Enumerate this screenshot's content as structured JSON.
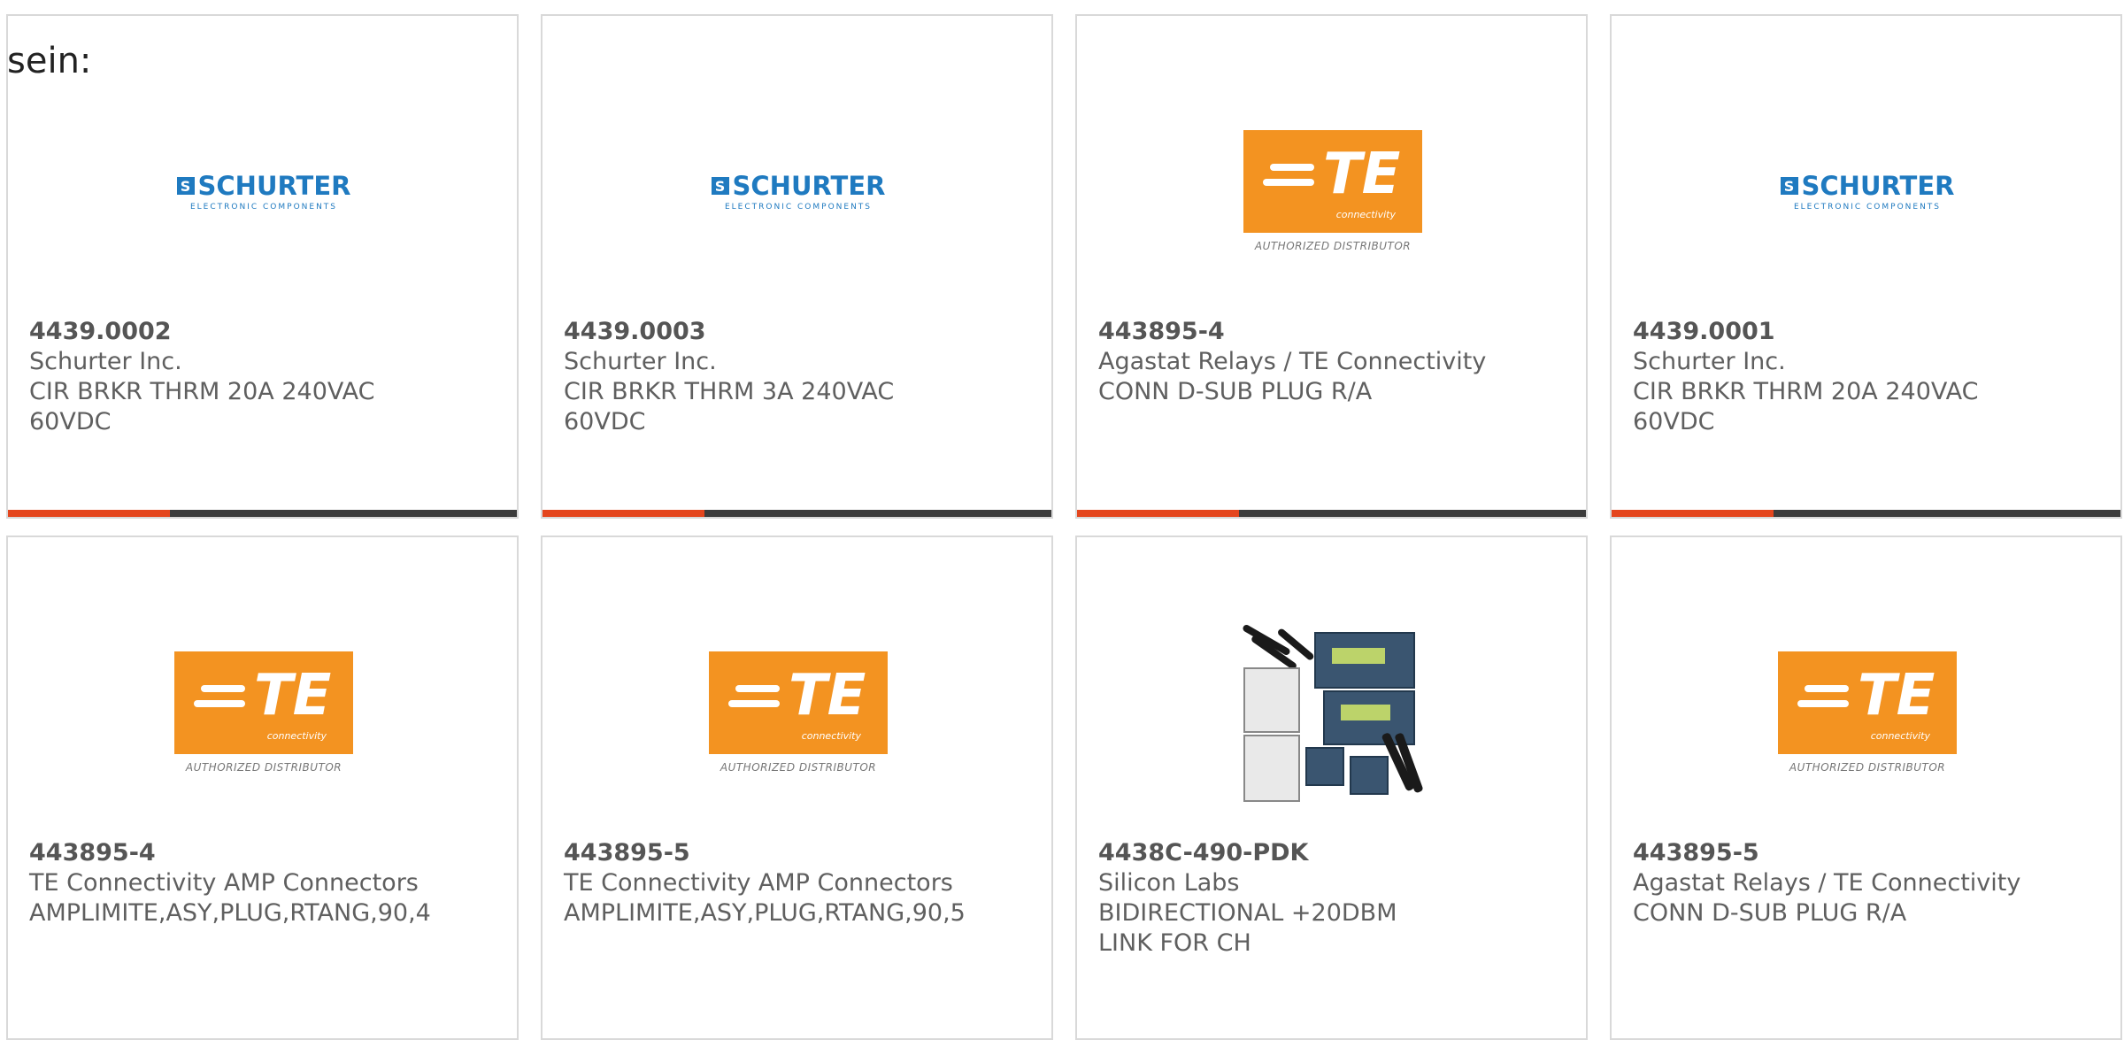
{
  "intro_text": "sein:",
  "icons": {
    "schurter_logo": "schurter-logo",
    "te_logo": "te-connectivity-logo",
    "kit_photo": "dev-kit-photo"
  },
  "colors": {
    "accent_bar": "#e4461e",
    "dark_bar": "#3c3c3c",
    "schurter_blue": "#1f7ac0",
    "te_orange": "#f39321"
  },
  "logo_text": {
    "schurter_mark": "S",
    "schurter_word": "SCHURTER",
    "schurter_sub": "ELECTRONIC COMPONENTS",
    "te_letters": "TE",
    "te_conn": "connectivity",
    "te_dist": "AUTHORIZED DISTRIBUTOR"
  },
  "products": [
    {
      "part": "4439.0002",
      "manufacturer": "Schurter Inc.",
      "description": "CIR BRKR THRM 20A 240VAC 60VDC",
      "logo": "schurter",
      "show_bar": true
    },
    {
      "part": "4439.0003",
      "manufacturer": "Schurter Inc.",
      "description": "CIR BRKR THRM 3A 240VAC 60VDC",
      "logo": "schurter",
      "show_bar": true
    },
    {
      "part": "443895-4",
      "manufacturer": "Agastat Relays / TE Connectivity",
      "description": "CONN D-SUB PLUG R/A",
      "logo": "te",
      "show_bar": true
    },
    {
      "part": "4439.0001",
      "manufacturer": "Schurter Inc.",
      "description": "CIR BRKR THRM 20A 240VAC 60VDC",
      "logo": "schurter",
      "show_bar": true
    },
    {
      "part": "443895-4",
      "manufacturer": "TE Connectivity AMP Connectors",
      "description": "AMPLIMITE,ASY,PLUG,RTANG,90,4",
      "logo": "te",
      "show_bar": false
    },
    {
      "part": "443895-5",
      "manufacturer": "TE Connectivity AMP Connectors",
      "description": "AMPLIMITE,ASY,PLUG,RTANG,90,5",
      "logo": "te",
      "show_bar": false
    },
    {
      "part": "4438C-490-PDK",
      "manufacturer": "Silicon Labs",
      "description": "BIDIRECTIONAL +20DBM LINK FOR CH",
      "logo": "kit",
      "show_bar": false
    },
    {
      "part": "443895-5",
      "manufacturer": "Agastat Relays / TE Connectivity",
      "description": "CONN D-SUB PLUG R/A",
      "logo": "te",
      "show_bar": false
    }
  ]
}
